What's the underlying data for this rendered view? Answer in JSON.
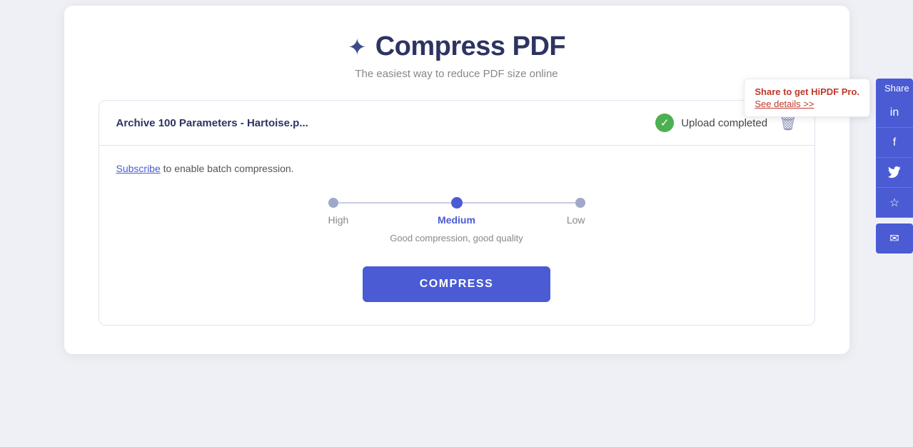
{
  "page": {
    "title": "Compress PDF",
    "subtitle": "The easiest way to reduce PDF size online",
    "icon": "✦"
  },
  "file": {
    "name": "Archive 100 Parameters - Hartoise.p...",
    "upload_status": "Upload completed"
  },
  "subscribe": {
    "link_text": "Subscribe",
    "rest_text": " to enable batch compression."
  },
  "compression": {
    "levels": [
      {
        "id": "high",
        "label": "High",
        "active": false
      },
      {
        "id": "medium",
        "label": "Medium",
        "active": true
      },
      {
        "id": "low",
        "label": "Low",
        "active": false
      }
    ],
    "description": "Good compression, good quality"
  },
  "buttons": {
    "compress": "COMPRESS"
  },
  "promo": {
    "title": "Share to get HiPDF Pro.",
    "link": "See details >>"
  },
  "share": {
    "label": "Share",
    "icons": [
      "in",
      "f",
      "🐦",
      "☆"
    ],
    "email_icon": "✉"
  }
}
